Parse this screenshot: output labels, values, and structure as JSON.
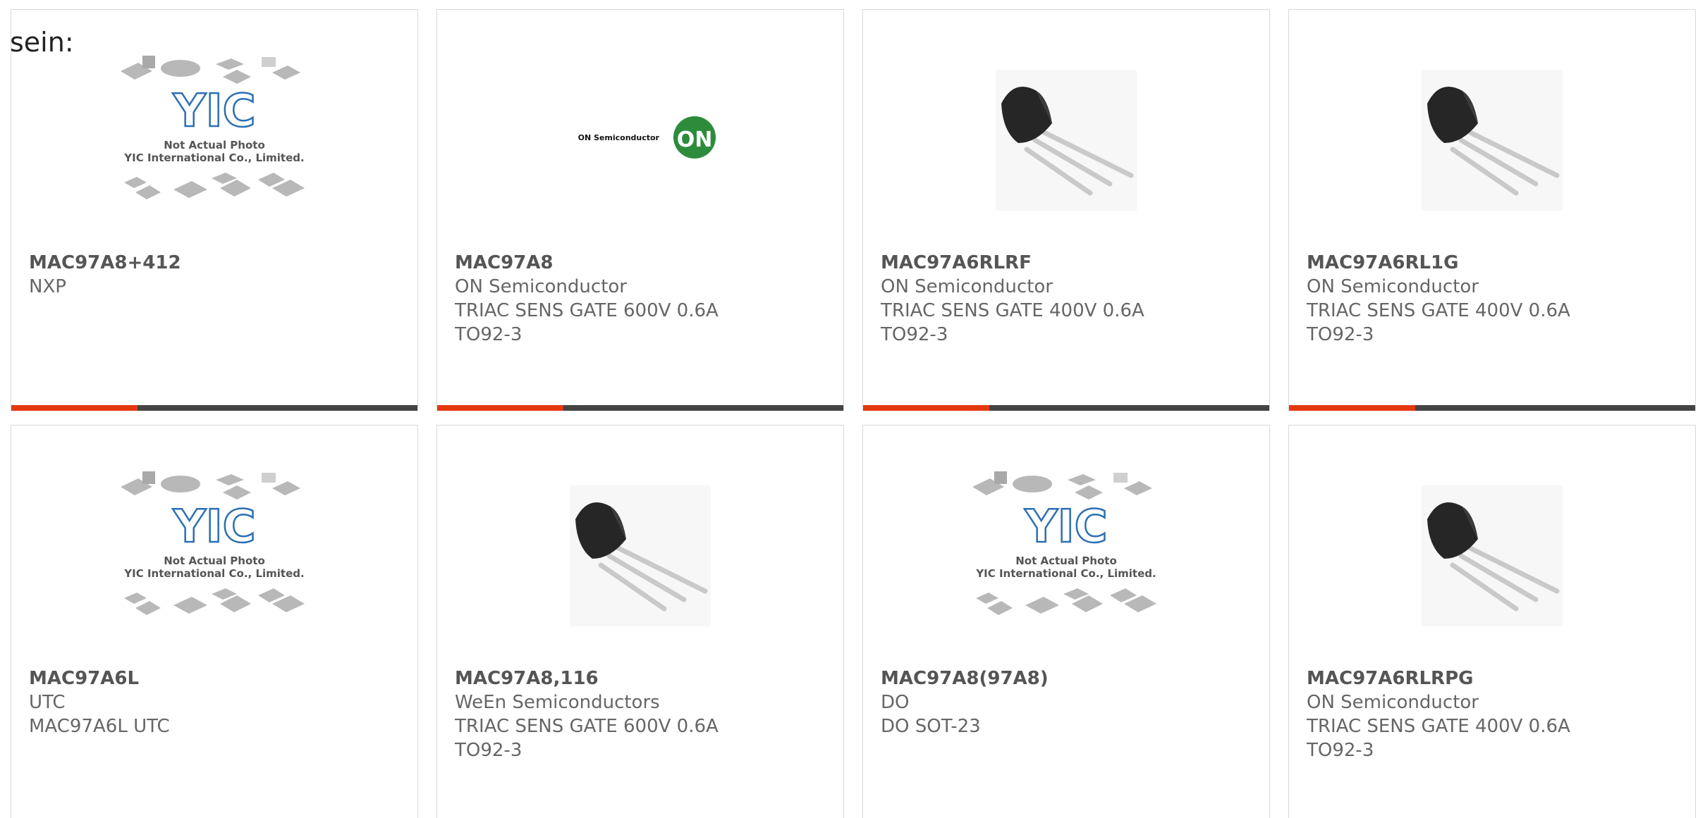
{
  "intro_text": "sein:",
  "colors": {
    "accent": "#e4380e",
    "track": "#444444",
    "on_logo_green": "#2d8c3c"
  },
  "cards": [
    {
      "part": "MAC97A8+412",
      "maker": "NXP",
      "desc": "",
      "pkg": "",
      "image": "yic-placeholder-image",
      "placeholder_title": "Not Actual Photo",
      "placeholder_company": "YIC International Co., Limited.",
      "progress": 0.31
    },
    {
      "part": "MAC97A8",
      "maker": "ON Semiconductor",
      "desc": "TRIAC SENS GATE 600V 0.6A",
      "pkg": "TO92-3",
      "image": "on-semiconductor-logo",
      "logo_text": "ON Semiconductor",
      "logo_mark": "ON",
      "progress": 0.31
    },
    {
      "part": "MAC97A6RLRF",
      "maker": "ON Semiconductor",
      "desc": "TRIAC SENS GATE 400V 0.6A",
      "pkg": "TO92-3",
      "image": "to92-component-photo",
      "progress": 0.31
    },
    {
      "part": "MAC97A6RL1G",
      "maker": "ON Semiconductor",
      "desc": "TRIAC SENS GATE 400V 0.6A",
      "pkg": "TO92-3",
      "image": "to92-component-photo",
      "progress": 0.31
    },
    {
      "part": "MAC97A6L",
      "maker": "UTC",
      "desc": "MAC97A6L UTC",
      "pkg": "",
      "image": "yic-placeholder-image",
      "placeholder_title": "Not Actual Photo",
      "placeholder_company": "YIC International Co., Limited."
    },
    {
      "part": "MAC97A8,116",
      "maker": "WeEn Semiconductors",
      "desc": "TRIAC SENS GATE 600V 0.6A",
      "pkg": "TO92-3",
      "image": "to92-component-photo"
    },
    {
      "part": "MAC97A8(97A8)",
      "maker": "DO",
      "desc": "DO SOT-23",
      "pkg": "",
      "image": "yic-placeholder-image",
      "placeholder_title": "Not Actual Photo",
      "placeholder_company": "YIC International Co., Limited."
    },
    {
      "part": "MAC97A6RLRPG",
      "maker": "ON Semiconductor",
      "desc": "TRIAC SENS GATE 400V 0.6A",
      "pkg": "TO92-3",
      "image": "to92-component-photo"
    }
  ]
}
